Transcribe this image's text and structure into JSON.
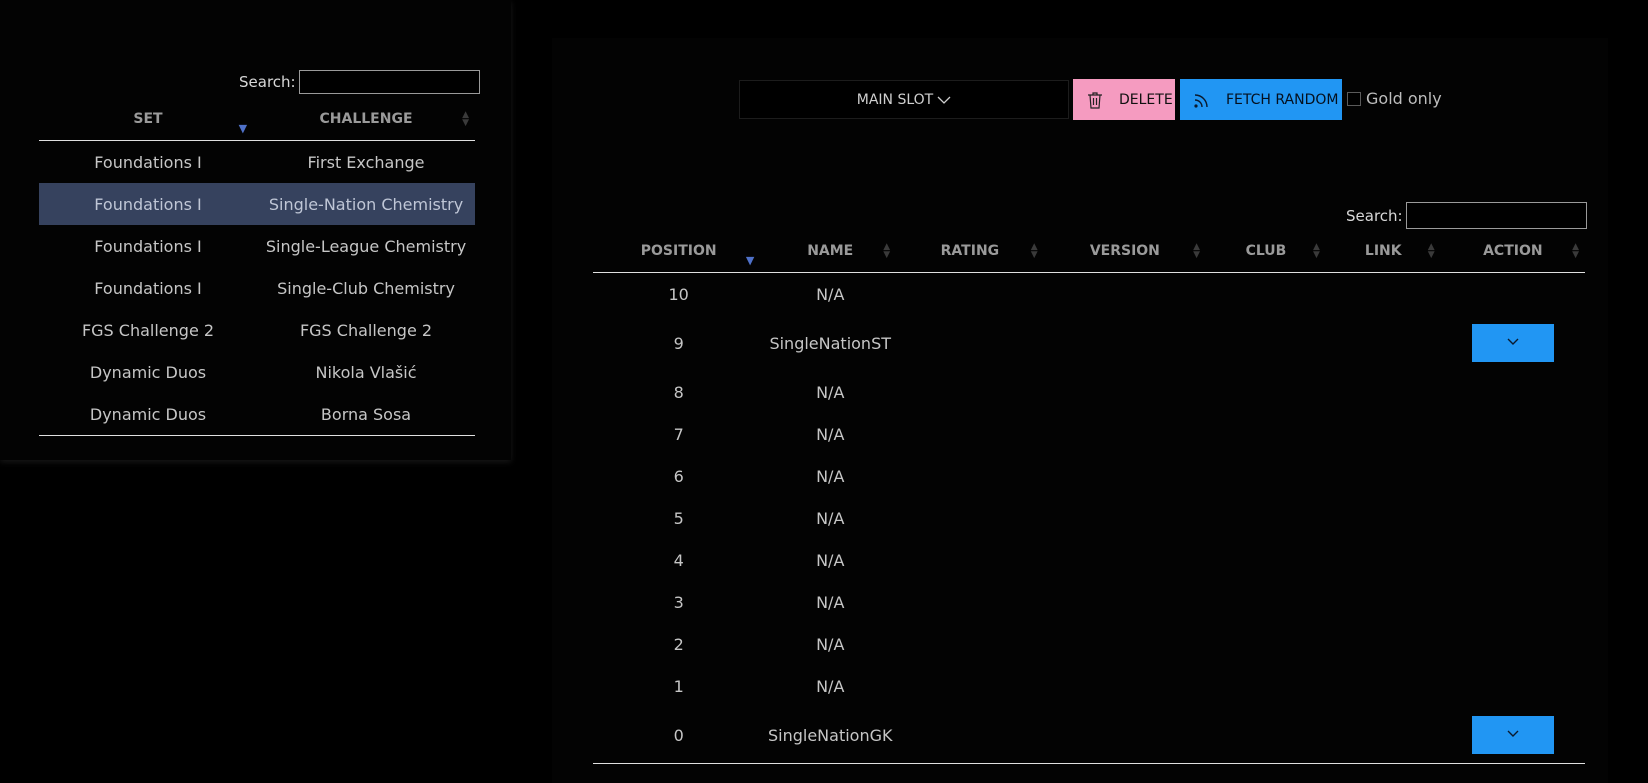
{
  "left": {
    "search_label": "Search:",
    "search_value": "",
    "columns": [
      "SET",
      "CHALLENGE"
    ],
    "rows": [
      {
        "set": "Foundations I",
        "challenge": "First Exchange"
      },
      {
        "set": "Foundations I",
        "challenge": "Single-Nation Chemistry"
      },
      {
        "set": "Foundations I",
        "challenge": "Single-League Chemistry"
      },
      {
        "set": "Foundations I",
        "challenge": "Single-Club Chemistry"
      },
      {
        "set": "FGS Challenge 2",
        "challenge": "FGS Challenge 2"
      },
      {
        "set": "Dynamic Duos",
        "challenge": "Nikola Vlašić"
      },
      {
        "set": "Dynamic Duos",
        "challenge": "Borna Sosa"
      }
    ],
    "selected_row_index": 1
  },
  "toolbar": {
    "slot_label": "MAIN SLOT",
    "delete_label": "DELETE",
    "fetch_label": "FETCH RANDOM",
    "gold_only_label": "Gold only",
    "gold_only_checked": false
  },
  "right": {
    "search_label": "Search:",
    "search_value": "",
    "columns": [
      "POSITION",
      "NAME",
      "RATING",
      "VERSION",
      "CLUB",
      "LINK",
      "ACTION"
    ],
    "rows": [
      {
        "position": "10",
        "name": "N/A",
        "has_action": false
      },
      {
        "position": "9",
        "name": "SingleNationST",
        "has_action": true
      },
      {
        "position": "8",
        "name": "N/A",
        "has_action": false
      },
      {
        "position": "7",
        "name": "N/A",
        "has_action": false
      },
      {
        "position": "6",
        "name": "N/A",
        "has_action": false
      },
      {
        "position": "5",
        "name": "N/A",
        "has_action": false
      },
      {
        "position": "4",
        "name": "N/A",
        "has_action": false
      },
      {
        "position": "3",
        "name": "N/A",
        "has_action": false
      },
      {
        "position": "2",
        "name": "N/A",
        "has_action": false
      },
      {
        "position": "1",
        "name": "N/A",
        "has_action": false
      },
      {
        "position": "0",
        "name": "SingleNationGK",
        "has_action": true
      }
    ]
  },
  "colors": {
    "accent_blue": "#2196f3",
    "delete_pink": "#f59bc0",
    "selected_row": "#36425e"
  }
}
